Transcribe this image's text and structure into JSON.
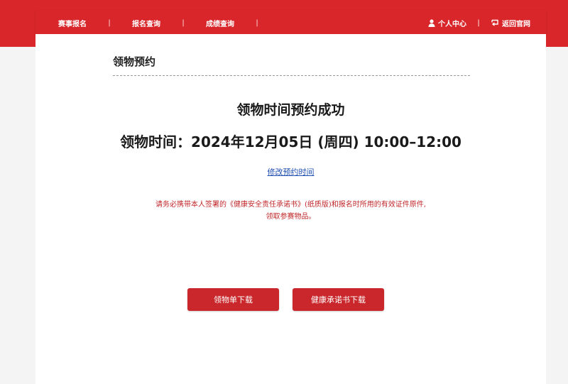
{
  "nav": {
    "left_items": [
      "赛事报名",
      "报名查询",
      "成绩查询"
    ],
    "separator": "|",
    "user_center": "个人中心",
    "back_official": "返回官网"
  },
  "main": {
    "section_title": "领物预约",
    "success_message": "领物时间预约成功",
    "pickup_time": "领物时间：2024年12月05日 (周四) 10:00–12:00",
    "modify_link": "修改预约时间",
    "notice_line1": "请务必携带本人签署的《健康安全责任承诺书》(纸质版)和报名时所用的有效证件原件,",
    "notice_line2": "领取参赛物品。",
    "button_pickup_form": "领物单下载",
    "button_health_pledge": "健康承诺书下载"
  },
  "colors": {
    "brand_red": "#d8262a",
    "button_red": "#c9272b",
    "notice_red": "#c0282b",
    "link_blue": "#1f4fb0"
  },
  "icons": [
    "user-icon",
    "return-icon"
  ]
}
